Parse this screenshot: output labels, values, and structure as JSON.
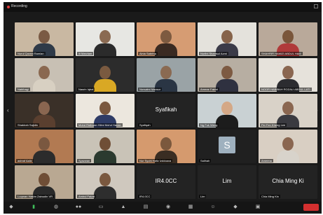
{
  "window": {
    "recording_label": "Recording"
  },
  "nav": {
    "prev": "‹",
    "next": "›"
  },
  "tiles": [
    {
      "name": "Nurul Qurani Ramlan",
      "bg": "#c9b8a2",
      "skin": "#7a5a44",
      "shirt": "#2f3a48",
      "type": "person"
    },
    {
      "name": "Ili Marzlam",
      "bg": "#e7e7e3",
      "skin": "#8a6a52",
      "shirt": "#2b2b2b",
      "type": "person"
    },
    {
      "name": "Ainia Sabrina",
      "bg": "#d69c73",
      "skin": "#7d5a40",
      "shirt": "#3a2a22",
      "type": "person"
    },
    {
      "name": "Nurlini Shamsul Azmi",
      "bg": "#e4e2dc",
      "skin": "#86634a",
      "shirt": "#3b3b48",
      "type": "person"
    },
    {
      "name": "SHAHRIR HAMIZI ABDUL HAM",
      "bg": "#b9a99a",
      "skin": "#7a563b",
      "shirt": "#b03a3a",
      "type": "person"
    },
    {
      "name": "Nabihagi",
      "bg": "#c8c0b4",
      "skin": "#8a6850",
      "shirt": "#d8d0c2",
      "type": "person"
    },
    {
      "name": "Nasrin Iqbal",
      "bg": "#2c2c2c",
      "skin": "#7a5a40",
      "shirt": "#d9a824",
      "type": "person"
    },
    {
      "name": "Norsalmi Mansor",
      "bg": "#9aa3a6",
      "skin": "#8a6a52",
      "shirt": "#2a3544",
      "type": "person"
    },
    {
      "name": "Ammar Fakhri",
      "bg": "#b7aea2",
      "skin": "#7d5a42",
      "shirt": "#2f3140",
      "type": "person"
    },
    {
      "name": "NOOR HABIBAH ROZALI ABDUL LATI",
      "bg": "#e6e2db",
      "skin": "#8a6650",
      "shirt": "#2c2c30",
      "type": "person"
    },
    {
      "name": "Shakirah Sajidin",
      "bg": "#3a3028",
      "skin": "#8a6650",
      "shirt": "#5a3f2f",
      "type": "person"
    },
    {
      "name": "Mohd Ridhwan Hilmi Mohd Hanan",
      "bg": "#ece7de",
      "skin": "#7a583f",
      "shirt": "#2f3c66",
      "type": "person"
    },
    {
      "name": "Syafiqah",
      "bg": "#232323",
      "type": "name",
      "center": "Syafikah"
    },
    {
      "name": "Ng Fuk Weng",
      "bg": "#c9d1d3",
      "skin": "#d4a886",
      "shirt": "#1c1c1c",
      "type": "person"
    },
    {
      "name": "Pei Fen Kheng Lee",
      "bg": "#d9d2c8",
      "skin": "#8a6650",
      "shirt": "#3a3a40",
      "type": "person"
    },
    {
      "name": "ashraf Aaliz",
      "bg": "#b27a52",
      "skin": "#7a5840",
      "shirt": "#2c2c2c",
      "type": "person"
    },
    {
      "name": "Syazwan",
      "bg": "#c9c3b7",
      "skin": "#6f4e36",
      "shirt": "#2b3a2f",
      "type": "person"
    },
    {
      "name": "Nur Syuhi Hafiz Izddoaxa",
      "bg": "#d59a6e",
      "skin": "#7b583d",
      "shirt": "#3a2d22",
      "type": "person"
    },
    {
      "name": "Salihah",
      "bg": "#202020",
      "type": "initial",
      "initial": "S"
    },
    {
      "name": "Ameena",
      "bg": "#d9cfc3",
      "skin": "#8a6650",
      "shirt": "#d8d3cb",
      "type": "person"
    },
    {
      "name": "Luqman Hakim Zainudin VR",
      "bg": "#b9a892",
      "skin": "#6f4e36",
      "shirt": "#2a2a2a",
      "type": "person"
    },
    {
      "name": "Amirul Faizat",
      "bg": "#cfc8be",
      "skin": "#7a583f",
      "shirt": "#2e2e2e",
      "type": "person"
    },
    {
      "name": "IR4.0CC",
      "bg": "#232323",
      "type": "name",
      "center": "IR4.0CC"
    },
    {
      "name": "Lim",
      "bg": "#232323",
      "type": "name",
      "center": "Lim"
    },
    {
      "name": "Chia Ming Kin",
      "bg": "#232323",
      "type": "name",
      "center": "Chia Ming Ki"
    }
  ],
  "toolbar": {
    "items": [
      {
        "name": "mute-icon",
        "glyph": "◆"
      },
      {
        "name": "video-icon",
        "glyph": "▮"
      },
      {
        "name": "security-icon",
        "glyph": "◍"
      },
      {
        "name": "participants-icon",
        "glyph": "●●"
      },
      {
        "name": "chat-icon",
        "glyph": "▭"
      },
      {
        "name": "share-screen-icon",
        "glyph": "▲"
      },
      {
        "name": "polls-icon",
        "glyph": "▤"
      },
      {
        "name": "record-icon",
        "glyph": "◉"
      },
      {
        "name": "breakout-rooms-icon",
        "glyph": "▦"
      },
      {
        "name": "reactions-icon",
        "glyph": "☺"
      },
      {
        "name": "apps-icon",
        "glyph": "◆"
      },
      {
        "name": "whiteboard-icon",
        "glyph": "▣"
      }
    ]
  },
  "colors": {
    "end_button": "#d32f2f",
    "window_bg": "#1a1a1a",
    "toolbar_bg": "#151515"
  }
}
